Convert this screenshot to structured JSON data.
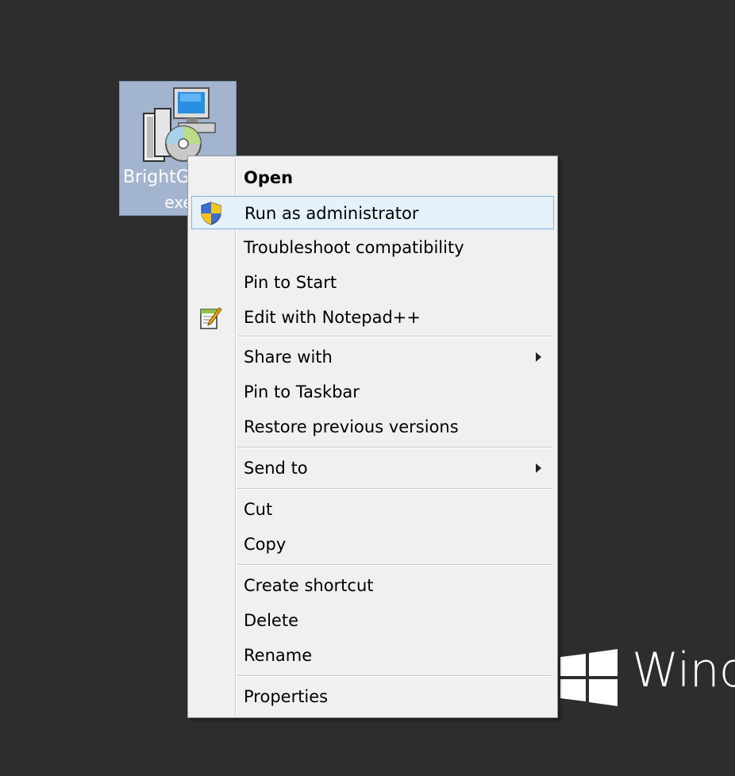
{
  "desktop": {
    "icon_label_line1": "BrightG",
    "icon_label_line2": "exe",
    "icon_name": "installer-icon",
    "brand_text": "Wind"
  },
  "menu": {
    "items": [
      {
        "label": "Open",
        "bold": true
      },
      {
        "label": "Run as administrator",
        "icon": "uac-shield-icon",
        "highlighted": true
      },
      {
        "label": "Troubleshoot compatibility"
      },
      {
        "label": "Pin to Start"
      },
      {
        "label": "Edit with Notepad++",
        "icon": "notepad-plus-plus-icon"
      },
      {
        "label": "Share with",
        "submenu": true
      },
      {
        "label": "Pin to Taskbar"
      },
      {
        "label": "Restore previous versions"
      },
      {
        "label": "Send to",
        "submenu": true
      },
      {
        "label": "Cut"
      },
      {
        "label": "Copy"
      },
      {
        "label": "Create shortcut"
      },
      {
        "label": "Delete"
      },
      {
        "label": "Rename"
      },
      {
        "label": "Properties"
      }
    ]
  },
  "colors": {
    "desktop_bg": "#2d2d2d",
    "menu_bg": "#f0f0f0",
    "highlight_bg": "#e5f1fb",
    "highlight_border": "#7eb4ea",
    "icon_selection": "#a3b4cf"
  }
}
